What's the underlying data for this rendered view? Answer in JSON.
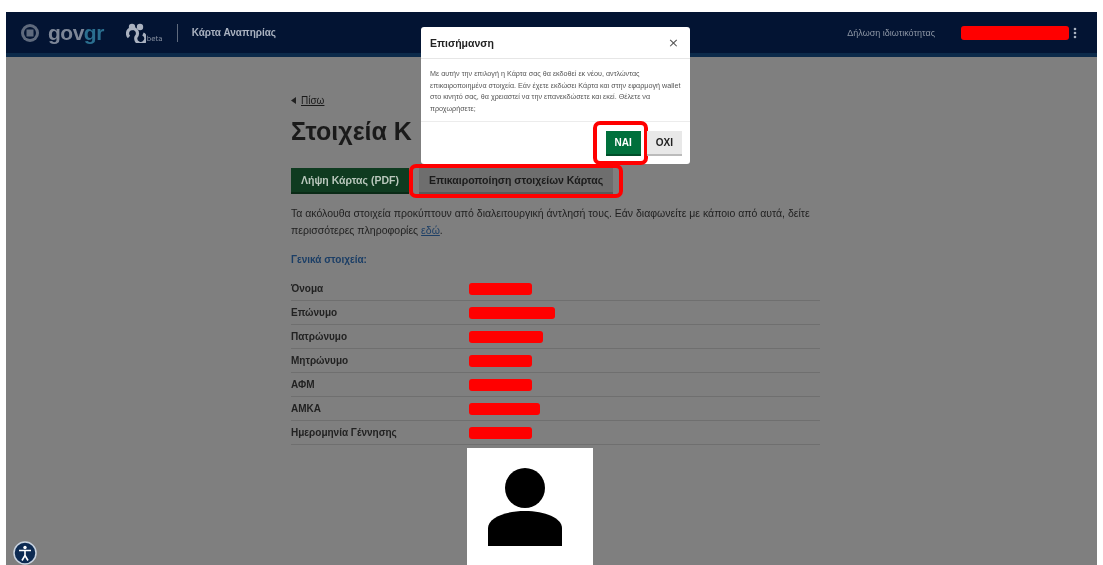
{
  "header": {
    "logo_parts": [
      "gov",
      "gr"
    ],
    "beta_label": "beta",
    "service_title": "Κάρτα Αναπηρίας",
    "privacy_link": "Δήλωση ιδιωτικότητας",
    "user_redacted": true
  },
  "page": {
    "back_link": "Πίσω",
    "title": "Στοιχεία Κ",
    "actions": [
      {
        "label": "Λήψη Κάρτας (PDF)",
        "kind": "primary",
        "highlighted": false
      },
      {
        "label": "Επικαιροποίηση στοιχείων Κάρτας",
        "kind": "secondary",
        "highlighted": true
      }
    ],
    "intro": "Τα ακόλουθα στοιχεία προκύπτουν από διαλειτουργική άντλησή τους. Εάν διαφωνείτε με κάποιο από αυτά, δείτε περισσότερες πληροφορίες ",
    "intro_link": "εδώ",
    "intro_end": ".",
    "section_title": "Γενικά στοιχεία:",
    "fields": [
      {
        "label": "Όνομα",
        "redacted": true
      },
      {
        "label": "Επώνυμο",
        "redacted": true
      },
      {
        "label": "Πατρώνυμο",
        "redacted": true
      },
      {
        "label": "Μητρώνυμο",
        "redacted": true
      },
      {
        "label": "ΑΦΜ",
        "redacted": true
      },
      {
        "label": "ΑΜΚΑ",
        "redacted": true
      },
      {
        "label": "Ημερομηνία Γέννησης",
        "redacted": true
      }
    ]
  },
  "dialog": {
    "title": "Επισήμανση",
    "close": "×",
    "message": "Με αυτήν την επιλογή η Κάρτα σας θα εκδοθεί εκ νέου, αντλώντας επικαιροποιημένα στοιχεία. Εάν έχετε εκδώσει Κάρτα και στην εφαρμογή wallet στο κινητό σας, θα χρειαστεί να την επανεκδώσετε και εκεί. Θέλετε να προχωρήσετε;",
    "buttons": [
      {
        "label": "ΝΑΙ",
        "kind": "primary",
        "highlighted": true
      },
      {
        "label": "ΟΧΙ",
        "kind": "secondary",
        "highlighted": false
      }
    ]
  }
}
